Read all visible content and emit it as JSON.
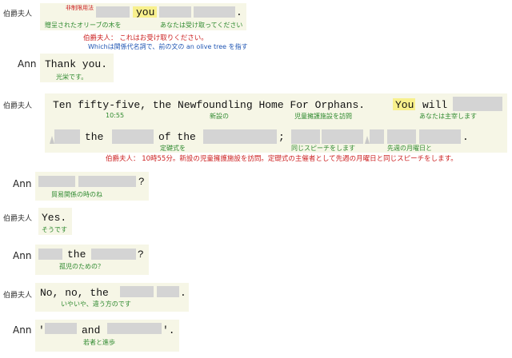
{
  "speakers": {
    "countess": "伯爵夫人",
    "ann": "Ann"
  },
  "line1": {
    "tag": "非制限用法",
    "word_you": "you",
    "period": ".",
    "gloss_left": "贈呈されたオリーブの木を",
    "gloss_right": "あなたは受け取ってください",
    "translation": "伯爵夫人： これはお受け取りください。",
    "note": "Whichは関係代名詞で、前の文の an olive tree を指す"
  },
  "line2": {
    "text": "Thank you.",
    "gloss": "光栄です。"
  },
  "line3": {
    "text": "Ten fifty-five, the Newfoundling Home For Orphans.",
    "word_you": "You",
    "word_will": "will",
    "gloss_time": "10:55",
    "gloss_new": "新設の",
    "gloss_orphan": "児童擁護施設を訪問",
    "gloss_you": "あなたは主宰します",
    "word_the": "the",
    "word_of_the": "of the",
    "semicolon": ";",
    "period": ".",
    "gloss_ceremony": "定礎式を",
    "gloss_speech": "同じスピーチをします",
    "gloss_monday": "先週の月曜日と",
    "translation": "伯爵夫人： 10時55分。新設の児童擁護施設を訪問。定礎式の主催者として先週の月曜日と同じスピーチをします。"
  },
  "line4": {
    "q": "?",
    "gloss": "貿易関係の時のね"
  },
  "line5": {
    "text": "Yes.",
    "gloss": "そうです"
  },
  "line6": {
    "word_the": "the",
    "q": "?",
    "gloss": "孤児のための？"
  },
  "line7": {
    "text": "No, no, the",
    "period": ".",
    "gloss": "いやいや、違う方のです"
  },
  "line8": {
    "open_quote": "'",
    "word_and": "and",
    "close": "'.",
    "gloss": "若者と進歩"
  },
  "colors": {
    "panel": "#f6f6e6",
    "blank": "#d4d4d4",
    "highlight": "#f8f08c",
    "gloss": "#2f8a2f",
    "translation": "#cc2020",
    "note": "#1f55b3"
  }
}
